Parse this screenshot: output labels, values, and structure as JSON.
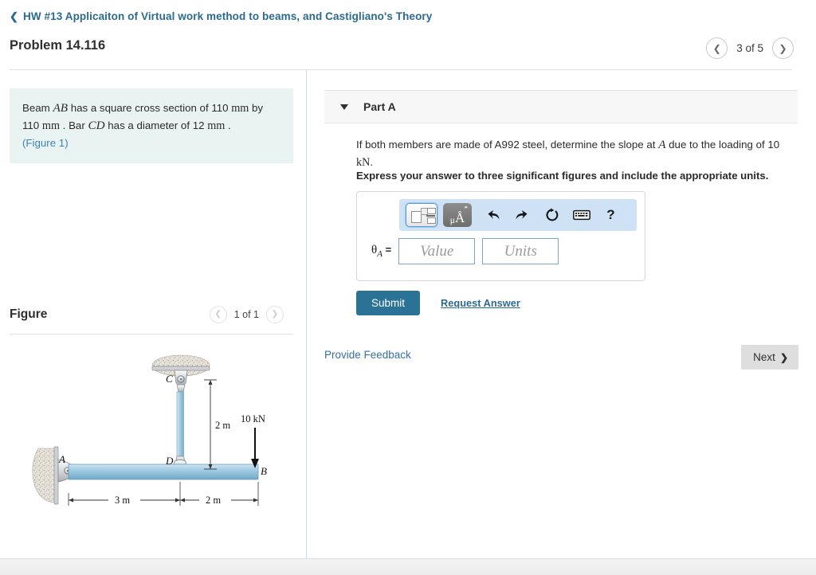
{
  "assignment": {
    "back_icon": "chevron-left-icon",
    "title": "HW #13 Applicaiton of Virtual work method to beams, and Castigliano's Theory"
  },
  "problem": {
    "title": "Problem 14.116",
    "pager": {
      "prev_icon": "chevron-left-icon",
      "next_icon": "chevron-right-icon",
      "text": "3 of 5"
    }
  },
  "statement": {
    "line1_a": "Beam ",
    "var_ab": "AB",
    "line1_b": " has a square cross section of 110 ",
    "unit_mm1": "mm",
    "line1_c": " by 110 ",
    "unit_mm2": "mm",
    "line1_d": " . Bar ",
    "var_cd": "CD",
    "line1_e": " has a diameter of 12 ",
    "unit_mm3": "mm",
    "line1_f": " .",
    "figure_link": "(Figure 1)"
  },
  "figure": {
    "label": "Figure",
    "pager": {
      "prev_icon": "chevron-left-icon",
      "next_icon": "chevron-right-icon",
      "text": "1 of 1"
    },
    "diagram": {
      "point_a": "A",
      "point_b": "B",
      "point_c": "C",
      "point_d": "D",
      "load_label": "10 kN",
      "dim_cd": "2 m",
      "dim_ad": "3 m",
      "dim_db": "2 m",
      "beam_color": "#8fc0dd",
      "bar_color": "#a8cde4"
    }
  },
  "part": {
    "caret_icon": "caret-down-icon",
    "title": "Part A",
    "question_a": "If both members are made of A992 steel, determine the slope at ",
    "question_var": "A",
    "question_b": " due to the loading of 10 ",
    "question_unit": "kN",
    "question_c": ".",
    "instruction": "Express your answer to three significant figures and include the appropriate units."
  },
  "answer": {
    "toolbar": {
      "template_icon": "math-template-icon",
      "units_icon": "micro-angstrom-units-icon",
      "units_label_mu": "μ",
      "units_label_a": "Å",
      "undo_icon": "undo-arrow-icon",
      "redo_icon": "redo-arrow-icon",
      "reset_icon": "reset-circular-arrow-icon",
      "keyboard_icon": "keyboard-icon",
      "help_icon": "help-question-icon",
      "help_label": "?"
    },
    "theta_symbol": "θ",
    "theta_sub": "A",
    "equals": "=",
    "value_placeholder": "Value",
    "units_placeholder": "Units",
    "value": "",
    "units": ""
  },
  "actions": {
    "submit_label": "Submit",
    "request_answer_label": "Request Answer",
    "feedback_label": "Provide Feedback",
    "next_label": "Next",
    "next_icon": "chevron-right-icon"
  },
  "colors": {
    "link": "#2b6a8f",
    "statement_bg": "#e9f3f2",
    "submit_bg": "#2a7296",
    "toolbar_bg": "#cfe2f5"
  }
}
